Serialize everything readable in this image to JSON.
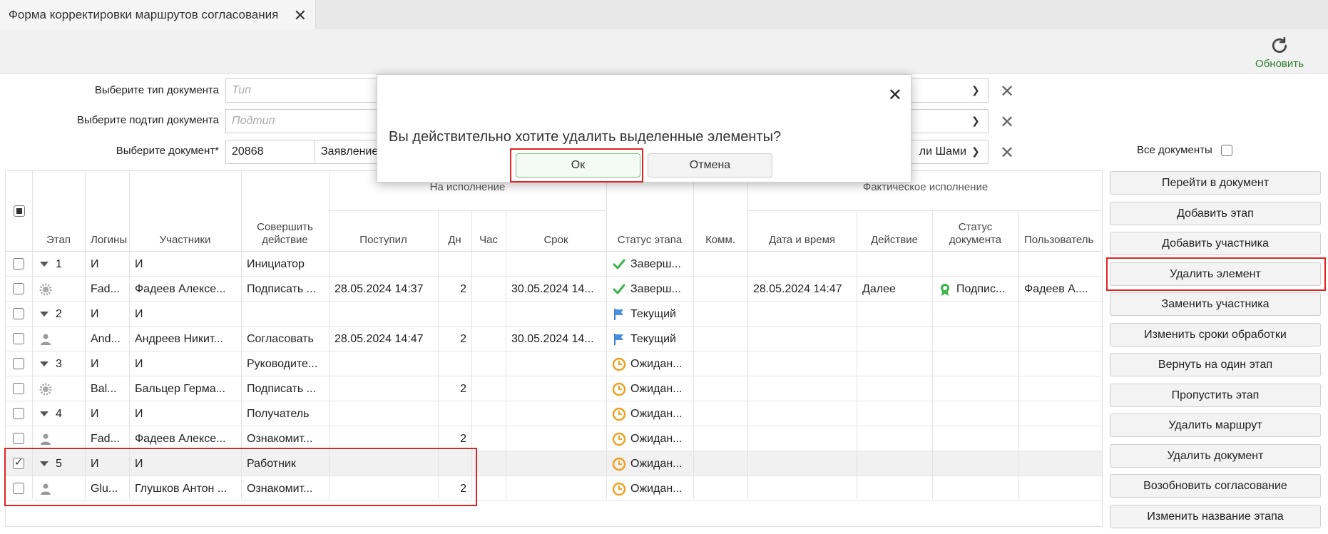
{
  "tab": {
    "title": "Форма корректировки маршрутов согласования",
    "close": "✕"
  },
  "toolbar": {
    "refresh_label": "Обновить"
  },
  "filters": {
    "type_label": "Выберите тип документа",
    "type_placeholder": "Тип",
    "subtype_label": "Выберите подтип документа",
    "subtype_placeholder": "Подтип",
    "doc_label": "Выберите документ*",
    "doc_number": "20868",
    "doc_name": "Заявление",
    "doc_right": "ли Шами"
  },
  "all_docs_label": "Все документы",
  "table": {
    "group_execution": "На исполнение",
    "group_actual": "Фактическое исполнение",
    "headers": {
      "stage": "Этап",
      "login": "Логины",
      "participants": "Участники",
      "action": "Совершить действие",
      "received": "Поступил",
      "days": "Дн",
      "hours": "Час",
      "deadline": "Срок",
      "status": "Статус этапа",
      "comment": "Комм.",
      "datetime": "Дата и время",
      "act": "Действие",
      "docstatus": "Статус документа",
      "user": "Пользователь"
    },
    "rows": [
      {
        "stage": "1",
        "login": "И",
        "part": "И",
        "action": "Инициатор",
        "received": "",
        "days": "",
        "deadline": "",
        "status": "Заверш...",
        "datetime": "",
        "act": "",
        "docstatus": "",
        "user": ""
      },
      {
        "stage": "",
        "login": "Fad...",
        "part": "Фадеев Алексе...",
        "action": "Подписать ...",
        "received": "28.05.2024 14:37",
        "days": "2",
        "deadline": "30.05.2024 14...",
        "status": "Заверш...",
        "datetime": "28.05.2024 14:47",
        "act": "Далее",
        "docstatus": "Подпис...",
        "user": "Фадеев А...."
      },
      {
        "stage": "2",
        "login": "И",
        "part": "И",
        "action": "",
        "received": "",
        "days": "",
        "deadline": "",
        "status": "Текущий",
        "datetime": "",
        "act": "",
        "docstatus": "",
        "user": ""
      },
      {
        "stage": "",
        "login": "And...",
        "part": "Андреев Никит...",
        "action": "Согласовать",
        "received": "28.05.2024 14:47",
        "days": "2",
        "deadline": "30.05.2024 14...",
        "status": "Текущий",
        "datetime": "",
        "act": "",
        "docstatus": "",
        "user": ""
      },
      {
        "stage": "3",
        "login": "И",
        "part": "И",
        "action": "Руководите...",
        "received": "",
        "days": "",
        "deadline": "",
        "status": "Ожидан...",
        "datetime": "",
        "act": "",
        "docstatus": "",
        "user": ""
      },
      {
        "stage": "",
        "login": "Bal...",
        "part": "Бальцер Герма...",
        "action": "Подписать ...",
        "received": "",
        "days": "2",
        "deadline": "",
        "status": "Ожидан...",
        "datetime": "",
        "act": "",
        "docstatus": "",
        "user": ""
      },
      {
        "stage": "4",
        "login": "И",
        "part": "И",
        "action": "Получатель",
        "received": "",
        "days": "",
        "deadline": "",
        "status": "Ожидан...",
        "datetime": "",
        "act": "",
        "docstatus": "",
        "user": ""
      },
      {
        "stage": "",
        "login": "Fad...",
        "part": "Фадеев Алексе...",
        "action": "Ознакомит...",
        "received": "",
        "days": "2",
        "deadline": "",
        "status": "Ожидан...",
        "datetime": "",
        "act": "",
        "docstatus": "",
        "user": ""
      },
      {
        "stage": "5",
        "login": "И",
        "part": "И",
        "action": "Работник",
        "received": "",
        "days": "",
        "deadline": "",
        "status": "Ожидан...",
        "datetime": "",
        "act": "",
        "docstatus": "",
        "user": ""
      },
      {
        "stage": "",
        "login": "Glu...",
        "part": "Глушков Антон ...",
        "action": "Ознакомит...",
        "received": "",
        "days": "2",
        "deadline": "",
        "status": "Ожидан...",
        "datetime": "",
        "act": "",
        "docstatus": "",
        "user": ""
      }
    ]
  },
  "actions": [
    "Перейти в документ",
    "Добавить этап",
    "Добавить участника",
    "Удалить элемент",
    "Заменить участника",
    "Изменить сроки обработки",
    "Вернуть на один этап",
    "Пропустить этап",
    "Удалить маршрут",
    "Удалить документ",
    "Возобновить согласование",
    "Изменить название этапа"
  ],
  "dialog": {
    "message": "Вы действительно хотите удалить выделенные элементы?",
    "ok": "Ок",
    "cancel": "Отмена",
    "close": "✕"
  },
  "colors": {
    "accent_green": "#2e7d32",
    "highlight_red": "#e02424",
    "flag_blue": "#4a90e2",
    "clock_orange": "#f0a020"
  }
}
